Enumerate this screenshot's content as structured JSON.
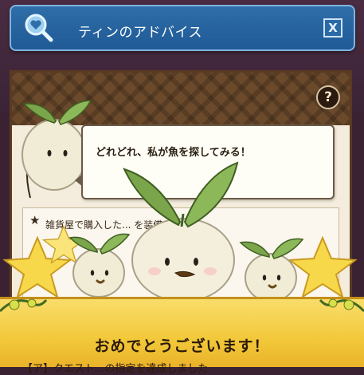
{
  "window": {
    "title": "ティンのアドバイス",
    "close_label": "X",
    "icon": "search-heart-icon"
  },
  "panel": {
    "help_label": "?",
    "speech": "どれどれ、私が魚を探してみる！",
    "info_star": "★",
    "info_text": "雑貨屋で購入した... を装備して"
  },
  "banner": {
    "title": "おめでとうございます！",
    "subtitle": "【ア】クエスト...の指定を達成しました"
  },
  "colors": {
    "titlebar": "#2f6ea8",
    "panel_band": "#6b4a2c",
    "banner": "#f2c83a"
  }
}
